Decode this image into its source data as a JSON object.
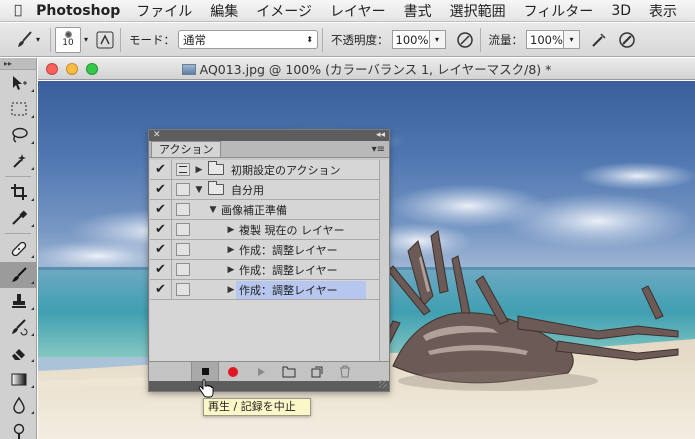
{
  "menubar": {
    "app": "Photoshop",
    "items": [
      "ファイル",
      "編集",
      "イメージ",
      "レイヤー",
      "書式",
      "選択範囲",
      "フィルター",
      "3D",
      "表示"
    ]
  },
  "options_bar": {
    "brush_size": "10",
    "mode_label": "モード：",
    "mode_value": "通常",
    "opacity_label": "不透明度：",
    "opacity_value": "100%",
    "flow_label": "流量：",
    "flow_value": "100%"
  },
  "document": {
    "title": "AQ013.jpg @ 100% (カラーバランス 1, レイヤーマスク/8) *"
  },
  "actions_panel": {
    "tab_label": "アクション",
    "rows": [
      {
        "label": "初期設定のアクション",
        "checked": true,
        "dialog": true,
        "expanded": false,
        "indent": 0,
        "folder": true,
        "selected": false
      },
      {
        "label": "自分用",
        "checked": true,
        "dialog": false,
        "expanded": true,
        "indent": 0,
        "folder": true,
        "selected": false
      },
      {
        "label": "画像補正準備",
        "checked": true,
        "dialog": false,
        "expanded": true,
        "indent": 1,
        "folder": false,
        "selected": false
      },
      {
        "label": "複製 現在の レイヤー",
        "checked": true,
        "dialog": false,
        "expanded": false,
        "indent": 2,
        "folder": false,
        "selected": false
      },
      {
        "label": "作成：調整レイヤー",
        "checked": true,
        "dialog": false,
        "expanded": false,
        "indent": 2,
        "folder": false,
        "selected": false
      },
      {
        "label": "作成：調整レイヤー",
        "checked": true,
        "dialog": false,
        "expanded": false,
        "indent": 2,
        "folder": false,
        "selected": false
      },
      {
        "label": "作成：調整レイヤー",
        "checked": true,
        "dialog": false,
        "expanded": false,
        "indent": 2,
        "folder": false,
        "selected": true
      }
    ],
    "tooltip": "再生 / 記録を中止",
    "record_color": "#e0171d",
    "selection_color": "#b6c6ee"
  },
  "tools": [
    "move-tool-icon",
    "marquee-tool-icon",
    "lasso-tool-icon",
    "quick-selection-tool-icon",
    "crop-tool-icon",
    "eyedropper-tool-icon",
    "healing-brush-tool-icon",
    "brush-tool-icon",
    "clone-stamp-tool-icon",
    "history-brush-tool-icon",
    "eraser-tool-icon",
    "gradient-tool-icon",
    "blur-tool-icon",
    "dodge-tool-icon"
  ]
}
